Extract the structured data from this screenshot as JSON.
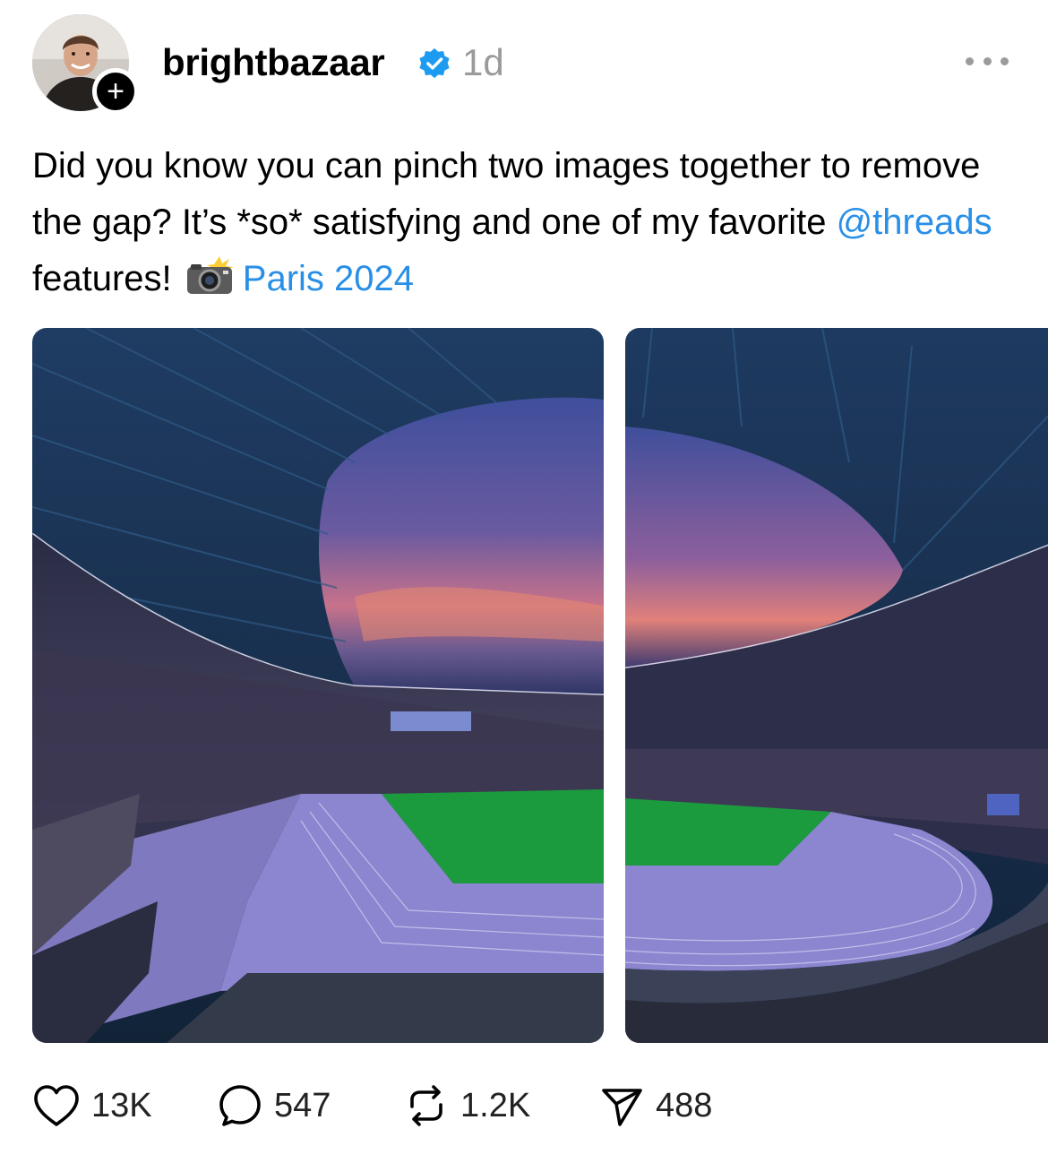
{
  "post": {
    "username": "brightbazaar",
    "time": "1d",
    "caption_text": "Did you know you can pinch two images together to remove the gap? It’s *so* satisfying and one of my favorite ",
    "mention": "@threads",
    "caption_after": " features! ",
    "location": "Paris 2024",
    "icons": {
      "follow": "plus-icon",
      "verified": "verified-badge-icon",
      "more": "more-dots-icon",
      "camera": "camera-flash-emoji"
    }
  },
  "colors": {
    "link": "#2a8fe6",
    "verified": "#1d9bf0",
    "secondary_text": "#9a9a9a"
  },
  "actions": {
    "likes": "13K",
    "replies": "547",
    "reposts": "1.2K",
    "shares": "488"
  }
}
